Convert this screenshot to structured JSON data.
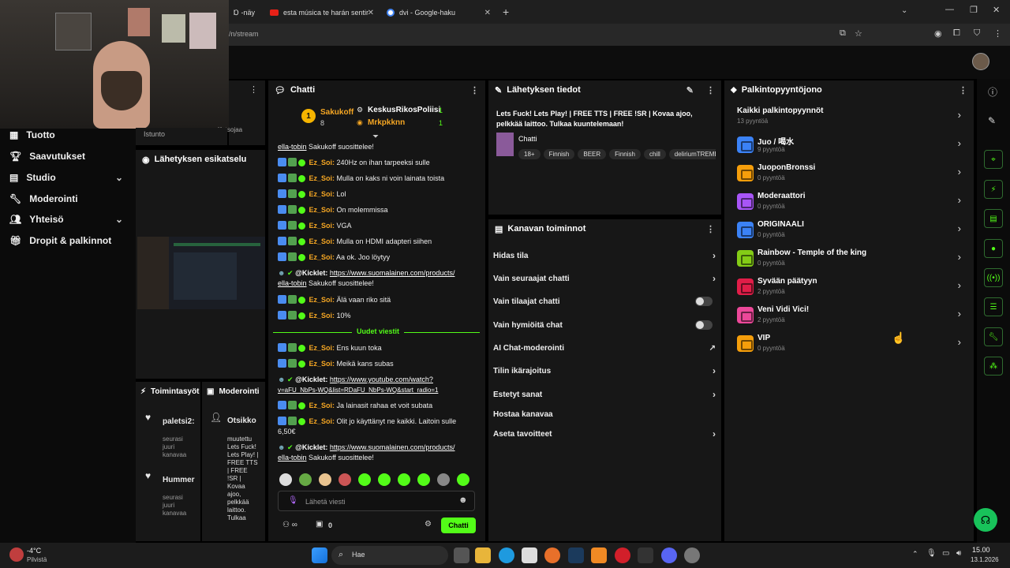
{
  "browser": {
    "tabs": [
      {
        "label": "Ɒ -näy"
      },
      {
        "label": "esta música te harán sentir"
      },
      {
        "label": "dvi - Google-haku"
      }
    ],
    "url": "/n/stream",
    "new_tab": "+"
  },
  "webcam": {
    "under_label": "Katsojaa",
    "istunto": "Istunto"
  },
  "leftnav": {
    "items": [
      {
        "label": "Tuotto"
      },
      {
        "label": "Saavutukset"
      },
      {
        "label": "Studio"
      },
      {
        "label": "Moderointi"
      },
      {
        "label": "Yhteisö"
      },
      {
        "label": "Dropit & palkinnot"
      }
    ]
  },
  "preview": {
    "title": "Lähetyksen esikatselu"
  },
  "activity": {
    "tab1": "Toimintasyöt",
    "tab2": "Moderointi",
    "items": [
      {
        "name": "paletsi2:",
        "desc": "seurasi juuri kanavaa"
      },
      {
        "name": "Hummer",
        "desc": "seurasi juuri kanavaa"
      }
    ],
    "mod_title": "Otsikko",
    "mod_text": "muutettu Lets Fuck! Lets Play! | FREE TTS | FREE !SR | Kovaa ajoo, pelkkää laittoo. Tulkaa"
  },
  "chat": {
    "title": "Chatti",
    "top_user": "Sakukoff",
    "top_rank": "1",
    "top_count": "8",
    "second_user": "KeskusRikosPoliisi",
    "second_count": "1",
    "third_user": "Mrkpkknn",
    "third_count": "1",
    "first_line_user": "ella-tobin",
    "first_line_text": "Sakukoff suosittelee!",
    "messages": [
      {
        "user": "Ez_Soi:",
        "text": "240Hz on ihan tarpeeksi sulle"
      },
      {
        "user": "Ez_Soi:",
        "text": "Mulla on kaks ni voin lainata toista"
      },
      {
        "user": "Ez_Soi:",
        "text": "Lol"
      },
      {
        "user": "Ez_Soi:",
        "text": "On molemmissa"
      },
      {
        "user": "Ez_Soi:",
        "text": "VGA"
      },
      {
        "user": "Ez_Soi:",
        "text": "Mulla on HDMI adapteri siihen"
      },
      {
        "user": "Ez_Soi:",
        "text": "Aa ok. Joo löytyy"
      }
    ],
    "kicklet1": {
      "user": "@Kicklet:",
      "link": "https://www.suomalainen.com/products/",
      "link2": "ella-tobin",
      "text": "Sakukoff suosittelee!"
    },
    "messages2": [
      {
        "user": "Ez_Soi:",
        "text": "Älä vaan riko sitä"
      },
      {
        "user": "Ez_Soi:",
        "text": "10%"
      }
    ],
    "new_messages": "Uudet viestit",
    "messages3": [
      {
        "user": "Ez_Soi:",
        "text": "Ens kuun toka"
      },
      {
        "user": "Ez_Soi:",
        "text": "Meikä kans subas"
      }
    ],
    "kicklet2": {
      "user": "@Kicklet:",
      "link": "https://www.youtube.com/watch?",
      "link2": "v=aFU_NbPs-WQ&list=RDaFU_NbPs-WQ&start_radio=1"
    },
    "messages4": [
      {
        "user": "Ez_Soi:",
        "text": "Ja lainasit rahaa et voit subata"
      },
      {
        "user": "Ez_Soi:",
        "text": "Olit jo käyttänyt ne kaikki. Laitoin sulle 6,50€"
      }
    ],
    "kicklet3": {
      "user": "@Kicklet:",
      "link": "https://www.suomalainen.com/products/",
      "link2": "ella-tobin",
      "text": "Sakukoff suosittelee!"
    },
    "input_placeholder": "Lähetä viesti",
    "points": "0",
    "send_label": "Chatti"
  },
  "streaminfo": {
    "title": "Lähetyksen tiedot",
    "stream_title": "Lets Fuck! Lets Play! | FREE TTS | FREE !SR | Kovaa ajoo, pelkkää laittoo. Tulkaa kuuntelemaan!",
    "category": "Chatti",
    "tags": [
      "18+",
      "Finnish",
      "BEER",
      "Finnish",
      "chill",
      "deliriumTREME"
    ]
  },
  "channelactions": {
    "title": "Kanavan toiminnot",
    "items": [
      {
        "label": "Hidas tila"
      },
      {
        "label": "Vain seuraajat chatti"
      },
      {
        "label": "Vain tilaajat chatti"
      },
      {
        "label": "Vain hymiöitä chat"
      },
      {
        "label": "AI Chat-moderointi"
      },
      {
        "label": "Tilin ikärajoitus"
      },
      {
        "label": "Estetyt sanat"
      },
      {
        "label": "Hostaa kanavaa"
      },
      {
        "label": "Aseta tavoitteet"
      }
    ]
  },
  "rewards": {
    "title": "Palkintopyyntöjono",
    "all_title": "Kaikki palkintopyynnöt",
    "all_count": "13 pyyntöä",
    "items": [
      {
        "name": "Juo / 喝水",
        "count": "9 pyyntöä",
        "color": "#3b82f6"
      },
      {
        "name": "JuoponBronssi",
        "count": "0 pyyntöä",
        "color": "#f59e0b"
      },
      {
        "name": "Moderaattori",
        "count": "0 pyyntöä",
        "color": "#a855f7"
      },
      {
        "name": "ORIGINAALI",
        "count": "0 pyyntöä",
        "color": "#3b82f6"
      },
      {
        "name": "Rainbow - Temple of the king",
        "count": "0 pyyntöä",
        "color": "#84cc16"
      },
      {
        "name": "Syvään päätyyn",
        "count": "2 pyyntöä",
        "color": "#e11d48"
      },
      {
        "name": "Veni Vidi Vici!",
        "count": "2 pyyntöä",
        "color": "#ec4899"
      },
      {
        "name": "VIP",
        "count": "0 pyyntöä",
        "color": "#f59e0b"
      }
    ]
  },
  "taskbar": {
    "temp": "-4°C",
    "weather": "Pilvistä",
    "search": "Hae",
    "time": "15.00",
    "date": "13.1.2026"
  },
  "colors": {
    "accent": "#53fc18",
    "bg": "#000000",
    "panel": "#171717"
  }
}
